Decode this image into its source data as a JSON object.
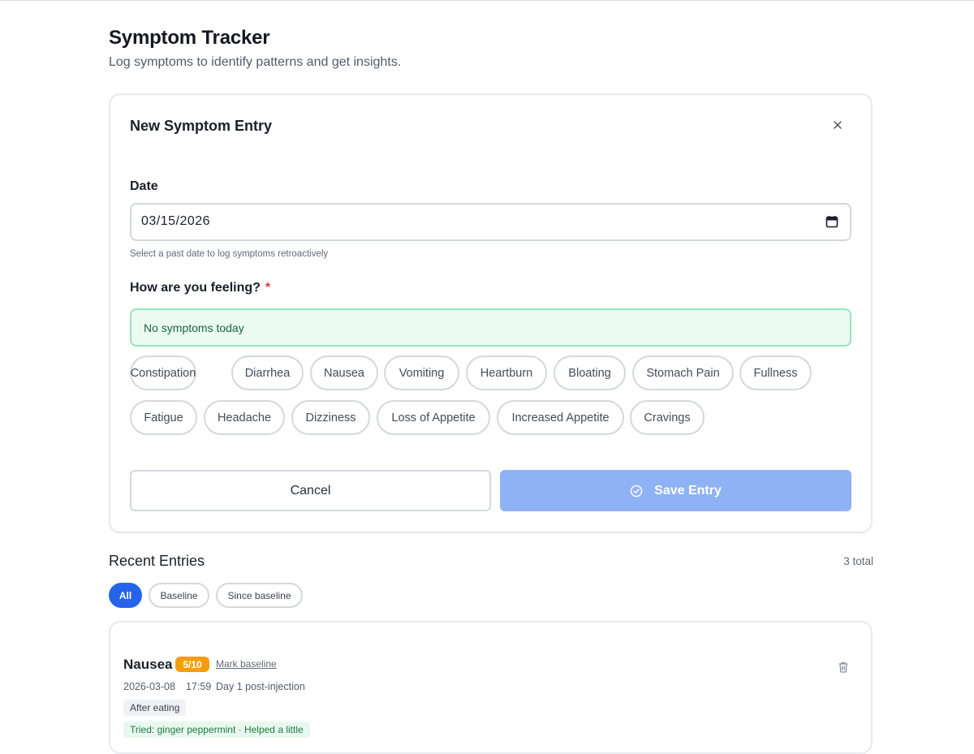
{
  "header": {
    "title": "Symptom Tracker",
    "subtitle": "Log symptoms to identify patterns and get insights."
  },
  "form": {
    "title": "New Symptom Entry",
    "close_icon": "close-icon",
    "date_label": "Date",
    "date_value": "03/15/2026",
    "date_hint": "Select a past date to log symptoms retroactively",
    "feeling_label": "How are you feeling?",
    "required_marker": "*",
    "no_symptoms_label": "No symptoms today",
    "symptoms": [
      "Constipation",
      "Diarrhea",
      "Nausea",
      "Vomiting",
      "Heartburn",
      "Bloating",
      "Stomach Pain",
      "Fullness",
      "Fatigue",
      "Headache",
      "Dizziness",
      "Loss of Appetite",
      "Increased Appetite",
      "Cravings"
    ],
    "cancel_label": "Cancel",
    "save_label": "Save Entry"
  },
  "recent": {
    "title": "Recent Entries",
    "total_label": "3 total",
    "filters": [
      "All",
      "Baseline",
      "Since baseline"
    ],
    "active_filter": "All",
    "entries": [
      {
        "symptom": "Nausea",
        "severity": "5/10",
        "mark_baseline_label": "Mark baseline",
        "date": "2026-03-08",
        "time": "17:59",
        "context": "Day 1 post-injection",
        "tag": "After eating",
        "tried": "Tried: ginger peppermint · Helped a little"
      }
    ]
  },
  "colors": {
    "accent": "#2563eb",
    "save_disabled": "#8fb2f5",
    "severity_badge": "#f59e0b",
    "no_symptoms_bg": "#ebfbf3",
    "no_symptoms_border": "#98e2bf"
  }
}
